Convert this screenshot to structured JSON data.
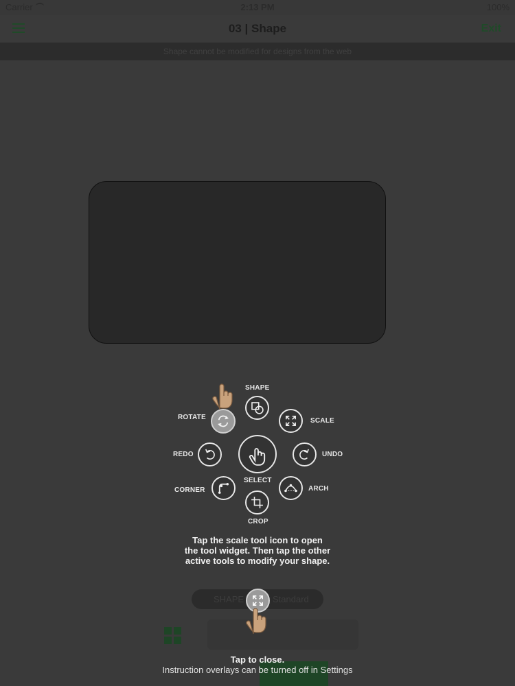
{
  "status_bar": {
    "carrier": "Carrier",
    "time": "2:13 PM",
    "battery": "100%"
  },
  "nav": {
    "title": "03 | Shape",
    "exit_label": "Exit"
  },
  "notice": "Shape cannot be modified for designs from the web",
  "shape_pill": {
    "label_left": "SHAPE",
    "label_right": "Standard"
  },
  "tools": {
    "shape": "SHAPE",
    "rotate": "ROTATE",
    "scale": "SCALE",
    "redo": "REDO",
    "undo": "UNDO",
    "select": "SELECT",
    "corner": "CORNER",
    "arch": "ARCH",
    "crop": "CROP"
  },
  "instruction": {
    "line1": "Tap the scale tool icon to open",
    "line2": "the tool widget. Then tap the other",
    "line3": "active tools to modify your shape."
  },
  "close_text": "Tap to close.",
  "settings_text": "Instruction overlays can be turned off in Settings",
  "colors": {
    "accent": "#1f7a34",
    "overlay_bg": "#3a3a3a",
    "tool_stroke": "#e6e6e6"
  }
}
